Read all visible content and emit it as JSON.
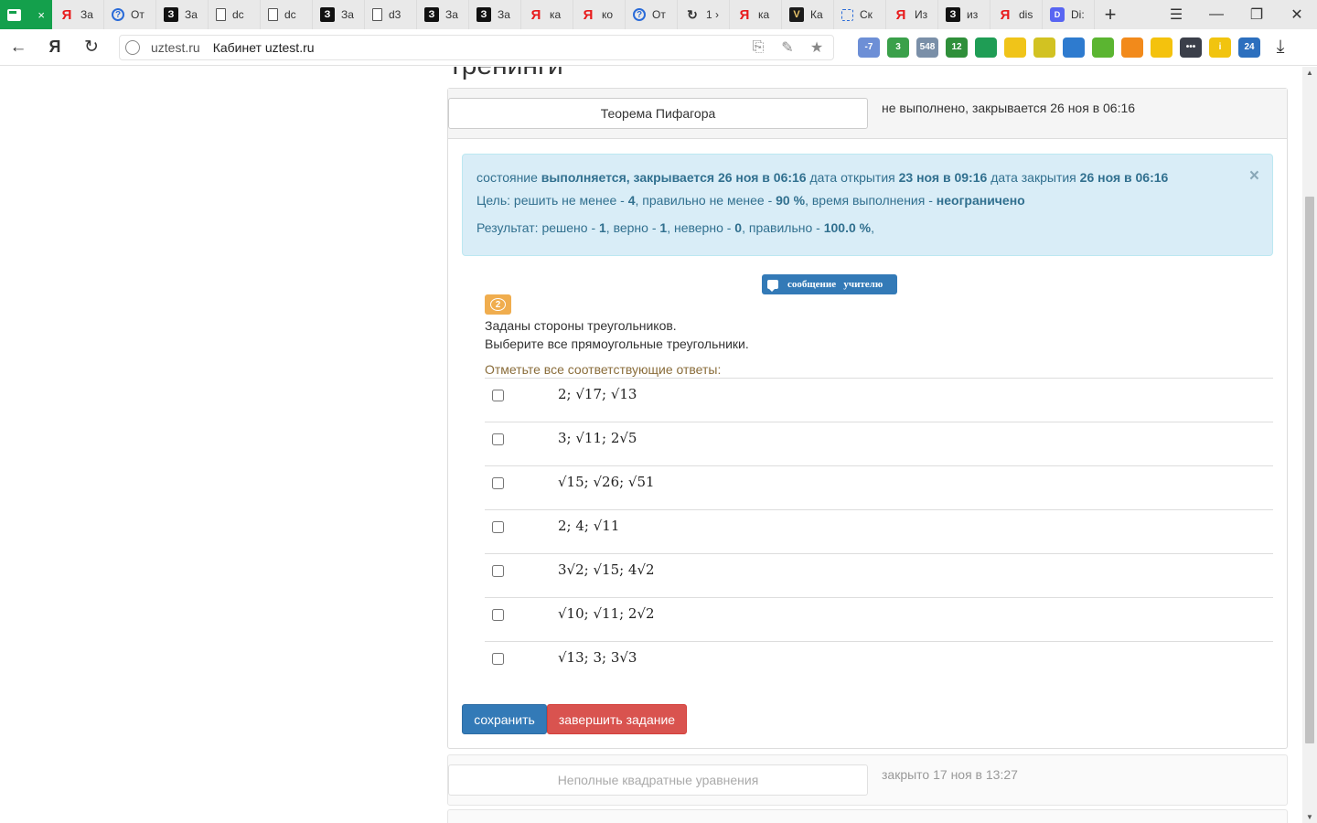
{
  "browser": {
    "tabs": [
      {
        "label": "",
        "icon": "sheets-icon",
        "active": true
      },
      {
        "label": "За",
        "icon": "yandex-icon"
      },
      {
        "label": "От",
        "icon": "question-icon"
      },
      {
        "label": "За",
        "icon": "znanija-icon"
      },
      {
        "label": "dc",
        "icon": "document-icon"
      },
      {
        "label": "dc",
        "icon": "document-icon"
      },
      {
        "label": "За",
        "icon": "znanija-icon"
      },
      {
        "label": "d3",
        "icon": "document-icon"
      },
      {
        "label": "За",
        "icon": "znanija-icon"
      },
      {
        "label": "За",
        "icon": "znanija-icon"
      },
      {
        "label": "ка",
        "icon": "yandex-icon"
      },
      {
        "label": "ко",
        "icon": "yandex-icon"
      },
      {
        "label": "От",
        "icon": "question-icon"
      },
      {
        "label": "1 ›",
        "icon": "loading-icon"
      },
      {
        "label": "ка",
        "icon": "yandex-icon"
      },
      {
        "label": "Ка",
        "icon": "v-icon"
      },
      {
        "label": "Ск",
        "icon": "screenshot-icon"
      },
      {
        "label": "Из",
        "icon": "yandex-icon"
      },
      {
        "label": "из",
        "icon": "znanija-icon"
      },
      {
        "label": "dis",
        "icon": "yandex-icon"
      },
      {
        "label": "Di:",
        "icon": "discord-icon"
      }
    ],
    "tab_close": "×",
    "new_tab": "+",
    "url_domain": "uztest.ru",
    "url_title": "Кабинет uztest.ru",
    "extensions": [
      {
        "name": "weather-icon",
        "text": "-7",
        "color": "#6d8fd6"
      },
      {
        "name": "green-counter-icon",
        "text": "3",
        "color": "#3aa04a"
      },
      {
        "name": "mail-icon",
        "text": "548",
        "color": "#7a8fa8"
      },
      {
        "name": "chat-icon",
        "text": "12",
        "color": "#2f8f3a"
      },
      {
        "name": "green-circle-icon",
        "text": "",
        "color": "#1f9d55"
      },
      {
        "name": "yellow-arrow-icon",
        "text": "",
        "color": "#f0c419"
      },
      {
        "name": "yellow-star-icon",
        "text": "",
        "color": "#d2c222"
      },
      {
        "name": "blue-bird-icon",
        "text": "",
        "color": "#2e7bcf"
      },
      {
        "name": "green-down-icon",
        "text": "",
        "color": "#5bb531"
      },
      {
        "name": "orange-shield-icon",
        "text": "",
        "color": "#f28a1b"
      },
      {
        "name": "yellow-cursor-icon",
        "text": "",
        "color": "#f4c20d"
      },
      {
        "name": "dots-icon",
        "text": "•••",
        "color": "#3b3f4a"
      },
      {
        "name": "yellow-i-icon",
        "text": "i",
        "color": "#f1c40f"
      },
      {
        "name": "calendar-icon",
        "text": "24",
        "color": "#2c6fbe"
      }
    ]
  },
  "page": {
    "section_heading": "тренинги",
    "task": {
      "title": "Теорема Пифагора",
      "status": "не выполнено, закрывается 26 ноя в 06:16"
    },
    "alert": {
      "state_label": "состояние",
      "state_value": "выполняется, закрывается 26 ноя в 06:16",
      "open_label": "дата открытия",
      "open_value": "23 ноя в 09:16",
      "close_label": "дата закрытия",
      "close_value": "26 ноя в 06:16",
      "goal_prefix": "Цель: решить не менее -",
      "goal_solved": "4",
      "goal_mid": ", правильно не менее -",
      "goal_percent": "90 %",
      "goal_time_label": ", время выполнения -",
      "goal_time_value": "неограничено",
      "result_prefix": "Результат: решено -",
      "result_solved": "1",
      "result_correct_label": ", верно -",
      "result_correct": "1",
      "result_wrong_label": ", неверно -",
      "result_wrong": "0",
      "result_percent_label": ", правильно -",
      "result_percent": "100.0 %",
      "result_suffix": ",",
      "close": "×"
    },
    "message_button": "сообщение   учителю",
    "question_number": "2",
    "question_line1": "Заданы стороны треугольников.",
    "question_line2": "Выберите все прямоугольные треугольники.",
    "hint": "Отметьте все соответствующие ответы:",
    "answers": [
      "2; √17; √13",
      "3; √11; 2√5",
      "√15; √26; √51",
      "2; 4; √11",
      "3√2; √15; 4√2",
      "√10; √11; 2√2",
      "√13; 3; 3√3"
    ],
    "save_label": "сохранить",
    "finish_label": "завершить задание",
    "task2": {
      "title": "Неполные квадратные уравнения",
      "status": "закрыто 17 ноя в 13:27"
    }
  }
}
